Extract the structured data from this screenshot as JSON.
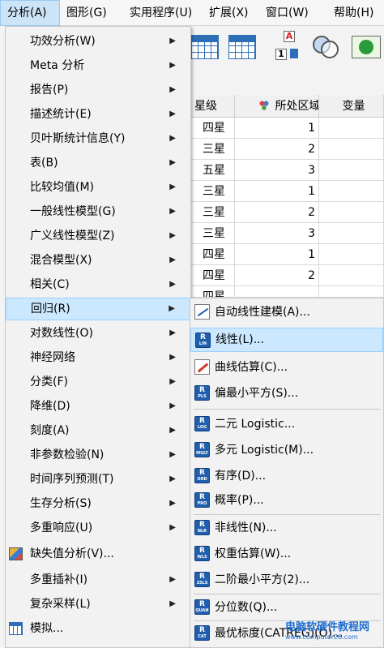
{
  "menubar": {
    "items": [
      {
        "label": "分析(A)",
        "active": true
      },
      {
        "label": "图形(G)"
      },
      {
        "label": "实用程序(U)"
      },
      {
        "label": "扩展(X)"
      },
      {
        "label": "窗口(W)"
      },
      {
        "label": "帮助(H)"
      }
    ]
  },
  "toolbar": {
    "icons": [
      "table-icon",
      "table-grid-icon",
      "value-labels-icon",
      "venn-icon",
      "add-icon"
    ],
    "letter_a": "A",
    "digit_1": "1"
  },
  "grid": {
    "headers": [
      "星级",
      "所处区域",
      "变量"
    ],
    "rows": [
      [
        "四星",
        "1"
      ],
      [
        "三星",
        "2"
      ],
      [
        "五星",
        "3"
      ],
      [
        "三星",
        "1"
      ],
      [
        "三星",
        "2"
      ],
      [
        "三星",
        "3"
      ],
      [
        "四星",
        "1"
      ],
      [
        "四星",
        "2"
      ],
      [
        "四星",
        ""
      ]
    ]
  },
  "analyze_menu": {
    "items": [
      {
        "label": "功效分析(W)",
        "submenu": true
      },
      {
        "label": "Meta 分析",
        "submenu": true
      },
      {
        "label": "报告(P)",
        "submenu": true
      },
      {
        "label": "描述统计(E)",
        "submenu": true
      },
      {
        "label": "贝叶斯统计信息(Y)",
        "submenu": true
      },
      {
        "label": "表(B)",
        "submenu": true
      },
      {
        "label": "比较均值(M)",
        "submenu": true
      },
      {
        "label": "一般线性模型(G)",
        "submenu": true
      },
      {
        "label": "广义线性模型(Z)",
        "submenu": true
      },
      {
        "label": "混合模型(X)",
        "submenu": true
      },
      {
        "label": "相关(C)",
        "submenu": true
      },
      {
        "label": "回归(R)",
        "submenu": true,
        "highlighted": true
      },
      {
        "label": "对数线性(O)",
        "submenu": true
      },
      {
        "label": "神经网络",
        "submenu": true
      },
      {
        "label": "分类(F)",
        "submenu": true
      },
      {
        "label": "降维(D)",
        "submenu": true
      },
      {
        "label": "刻度(A)",
        "submenu": true
      },
      {
        "label": "非参数检验(N)",
        "submenu": true
      },
      {
        "label": "时间序列预测(T)",
        "submenu": true
      },
      {
        "label": "生存分析(S)",
        "submenu": true
      },
      {
        "label": "多重响应(U)",
        "submenu": true
      },
      {
        "label": "缺失值分析(V)...",
        "icon": "missing-value-icon"
      },
      {
        "label": "多重插补(I)",
        "submenu": true
      },
      {
        "label": "复杂采样(L)",
        "submenu": true
      },
      {
        "label": "模拟...",
        "icon": "simulation-icon"
      }
    ],
    "arrow": "▶"
  },
  "regression_submenu": {
    "items": [
      {
        "label": "自动线性建模(A)...",
        "icon": "auto-linear-icon"
      },
      {
        "label": "线性(L)...",
        "icon_text": "LIN",
        "highlighted": true
      },
      {
        "label": "曲线估算(C)...",
        "icon": "curve-icon"
      },
      {
        "label": "偏最小平方(S)...",
        "icon_text": "PLS"
      },
      {
        "label": "二元 Logistic...",
        "icon_text": "LOG"
      },
      {
        "label": "多元 Logistic(M)...",
        "icon_text": "MULT"
      },
      {
        "label": "有序(D)...",
        "icon_text": "ORD"
      },
      {
        "label": "概率(P)...",
        "icon_text": "PRO"
      },
      {
        "label": "非线性(N)...",
        "icon_text": "NLR"
      },
      {
        "label": "权重估算(W)...",
        "icon_text": "WLS"
      },
      {
        "label": "二阶最小平方(2)...",
        "icon_text": "2SLS"
      },
      {
        "label": "分位数(Q)...",
        "icon_text": "QUAN"
      },
      {
        "label": "最优标度(CATREG)(O)...",
        "icon_text": "CAT"
      }
    ],
    "icon_letter": "R"
  },
  "watermark": {
    "line1": "电脑软硬件教程网",
    "line2": "www.computer26.com"
  },
  "colors": {
    "highlight": "#cce8ff",
    "highlight_border": "#99d1ff",
    "regression_icon": "#1f5fae",
    "menubar_active": "#cce4f7"
  }
}
